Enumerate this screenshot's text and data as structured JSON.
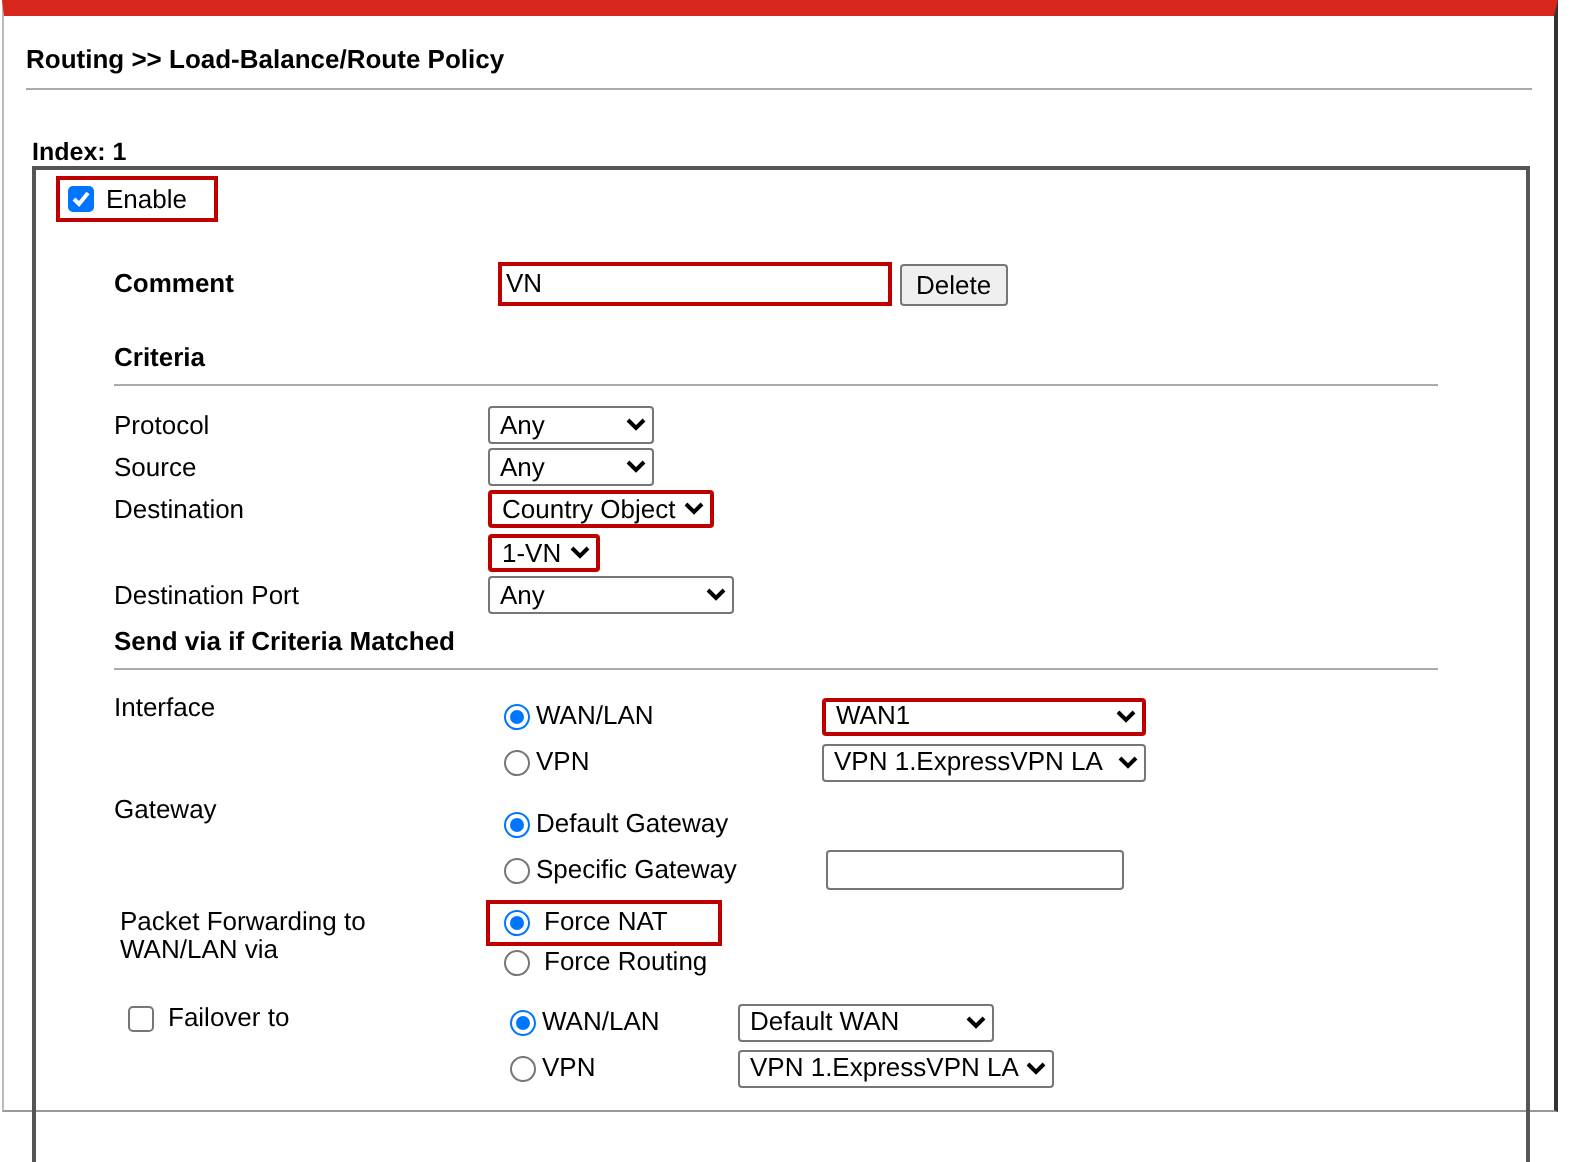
{
  "breadcrumb": "Routing >> Load-Balance/Route Policy",
  "index_label": "Index: 1",
  "enable": {
    "label": "Enable",
    "checked": true,
    "highlighted": true
  },
  "comment": {
    "label": "Comment",
    "value": "VN",
    "highlighted": true,
    "button": "Delete"
  },
  "criteria": {
    "heading": "Criteria",
    "rows": [
      {
        "label": "Protocol",
        "selects": [
          {
            "value": "Any",
            "highlighted": false
          }
        ]
      },
      {
        "label": "Source",
        "selects": [
          {
            "value": "Any",
            "highlighted": false
          }
        ]
      },
      {
        "label": "Destination",
        "selects": [
          {
            "value": "Country Object",
            "highlighted": true
          },
          {
            "value": "1-VN",
            "highlighted": true
          }
        ]
      },
      {
        "label": "Destination Port",
        "selects": [
          {
            "value": "Any",
            "highlighted": false
          }
        ]
      }
    ]
  },
  "send_via": {
    "heading": "Send via if Criteria Matched",
    "interface": {
      "label": "Interface",
      "options": [
        {
          "label": "WAN/LAN",
          "selected": true,
          "select": {
            "value": "WAN1",
            "highlighted": true
          }
        },
        {
          "label": "VPN",
          "selected": false,
          "select": {
            "value": "VPN 1.ExpressVPN LA",
            "highlighted": false
          }
        }
      ]
    },
    "gateway": {
      "label": "Gateway",
      "options": [
        {
          "label": "Default Gateway",
          "selected": true
        },
        {
          "label": "Specific Gateway",
          "selected": false,
          "kind": "input"
        }
      ]
    },
    "packet_forwarding": {
      "label": "Packet Forwarding to WAN/LAN via",
      "options": [
        {
          "label": "Force NAT",
          "selected": true,
          "highlighted": true
        },
        {
          "label": "Force Routing",
          "selected": false,
          "highlighted": false
        }
      ]
    },
    "failover": {
      "label": "Failover to",
      "checked": false,
      "options": [
        {
          "label": "WAN/LAN",
          "selected": true,
          "select": {
            "value": "Default WAN",
            "highlighted": false
          }
        },
        {
          "label": "VPN",
          "selected": false,
          "select": {
            "value": "VPN 1.ExpressVPN LA",
            "highlighted": false
          }
        }
      ]
    }
  }
}
